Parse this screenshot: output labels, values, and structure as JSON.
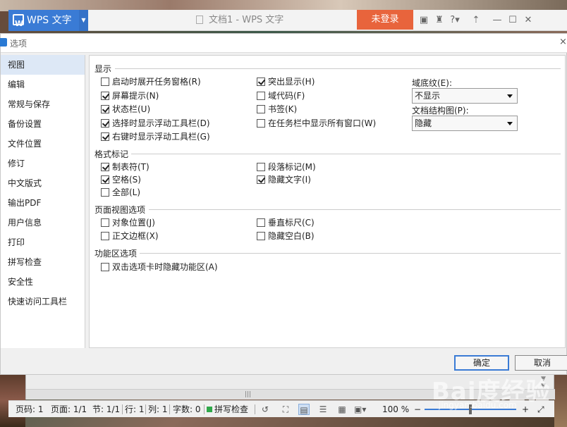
{
  "titlebar": {
    "brand": "WPS 文字",
    "doc_title": "文档1 - WPS 文字",
    "login": "未登录",
    "icons": [
      "skin-icon",
      "shirt-icon",
      "help-icon",
      "share-icon",
      "minimize-icon",
      "maximize-icon",
      "close-icon"
    ],
    "help_label": "?"
  },
  "dialog": {
    "title": "选项",
    "close": "×",
    "sidebar": [
      "视图",
      "编辑",
      "常规与保存",
      "备份设置",
      "文件位置",
      "修订",
      "中文版式",
      "输出PDF",
      "用户信息",
      "打印",
      "拼写检查",
      "安全性",
      "快速访问工具栏"
    ],
    "active_index": 0,
    "sections": {
      "display": "显示",
      "format_marks": "格式标记",
      "page_view": "页面视图选项",
      "ribbon": "功能区选项"
    },
    "display_col1": [
      {
        "label": "启动时展开任务窗格(R)",
        "checked": false
      },
      {
        "label": "屏幕提示(N)",
        "checked": true
      },
      {
        "label": "状态栏(U)",
        "checked": true
      },
      {
        "label": "选择时显示浮动工具栏(D)",
        "checked": true
      },
      {
        "label": "右键时显示浮动工具栏(G)",
        "checked": true
      }
    ],
    "display_col2": [
      {
        "label": "突出显示(H)",
        "checked": true
      },
      {
        "label": "域代码(F)",
        "checked": false
      },
      {
        "label": "书签(K)",
        "checked": false
      },
      {
        "label": "在任务栏中显示所有窗口(W)",
        "checked": false
      }
    ],
    "field_shading": {
      "label": "域底纹(E):",
      "value": "不显示"
    },
    "doc_map": {
      "label": "文档结构图(P):",
      "value": "隐藏"
    },
    "format_col1": [
      {
        "label": "制表符(T)",
        "checked": true
      },
      {
        "label": "空格(S)",
        "checked": true
      },
      {
        "label": "全部(L)",
        "checked": false
      }
    ],
    "format_col2": [
      {
        "label": "段落标记(M)",
        "checked": false
      },
      {
        "label": "隐藏文字(I)",
        "checked": true
      }
    ],
    "pageview_col1": [
      {
        "label": "对象位置(J)",
        "checked": false
      },
      {
        "label": "正文边框(X)",
        "checked": false
      }
    ],
    "pageview_col2": [
      {
        "label": "垂直标尺(C)",
        "checked": false
      },
      {
        "label": "隐藏空白(B)",
        "checked": false
      }
    ],
    "ribbon_opts": [
      {
        "label": "双击选项卡时隐藏功能区(A)",
        "checked": false
      }
    ],
    "ok": "确定",
    "cancel": "取消"
  },
  "statusbar": {
    "page": "页码: 1",
    "pages": "页面: 1/1",
    "section": "节: 1/1",
    "row": "行: 1",
    "col": "列: 1",
    "words": "字数: 0",
    "spell": "拼写检查",
    "zoom": "100 %",
    "zoom_fraction": 0.5
  },
  "watermark": "Bai度经验",
  "watermark_sub": "jingyan.baidu.com"
}
